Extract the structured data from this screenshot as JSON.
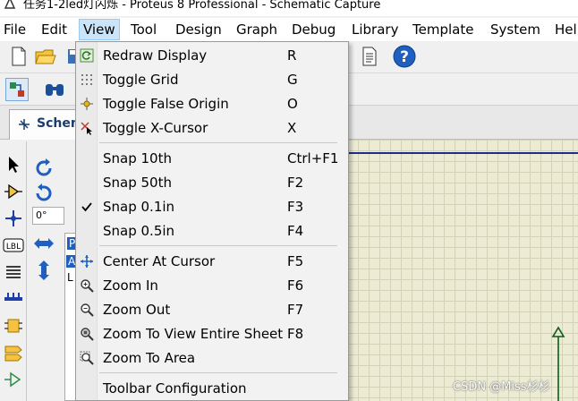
{
  "window": {
    "title": "任务1-2led灯闪烁 - Proteus 8 Professional - Schematic Capture"
  },
  "menubar": {
    "items": [
      "File",
      "Edit",
      "View",
      "Tool",
      "Design",
      "Graph",
      "Debug",
      "Library",
      "Template",
      "System",
      "Help"
    ]
  },
  "tab": {
    "label": "Schem"
  },
  "rotation": {
    "angle": "0°"
  },
  "object_panel": {
    "mode_letter": "P",
    "list_letter": "A",
    "list_letter2": "L"
  },
  "view_menu": {
    "items": [
      {
        "label": "Redraw Display",
        "shortcut": "R",
        "icon": "redraw-icon"
      },
      {
        "label": "Toggle Grid",
        "shortcut": "G",
        "icon": "grid-icon"
      },
      {
        "label": "Toggle False Origin",
        "shortcut": "O",
        "icon": "origin-icon"
      },
      {
        "label": "Toggle X-Cursor",
        "shortcut": "X",
        "icon": "x-cursor-icon"
      },
      {
        "label": "Snap 10th",
        "shortcut": "Ctrl+F1",
        "icon": ""
      },
      {
        "label": "Snap 50th",
        "shortcut": "F2",
        "icon": ""
      },
      {
        "label": "Snap 0.1in",
        "shortcut": "F3",
        "icon": "check-icon",
        "checked": true
      },
      {
        "label": "Snap 0.5in",
        "shortcut": "F4",
        "icon": ""
      },
      {
        "label": "Center At Cursor",
        "shortcut": "F5",
        "icon": "center-icon"
      },
      {
        "label": "Zoom In",
        "shortcut": "F6",
        "icon": "zoom-in-icon"
      },
      {
        "label": "Zoom Out",
        "shortcut": "F7",
        "icon": "zoom-out-icon"
      },
      {
        "label": "Zoom To View Entire Sheet",
        "shortcut": "F8",
        "icon": "zoom-fit-icon"
      },
      {
        "label": "Zoom To Area",
        "shortcut": "",
        "icon": "zoom-area-icon"
      },
      {
        "label": "Toolbar Configuration",
        "shortcut": "",
        "icon": ""
      }
    ]
  },
  "watermark": "CSDN @Miss杉杉",
  "colors": {
    "menu_highlight": "#cce4f7",
    "canvas": "#ecebd3",
    "sheet_border": "#1f2d8c"
  }
}
